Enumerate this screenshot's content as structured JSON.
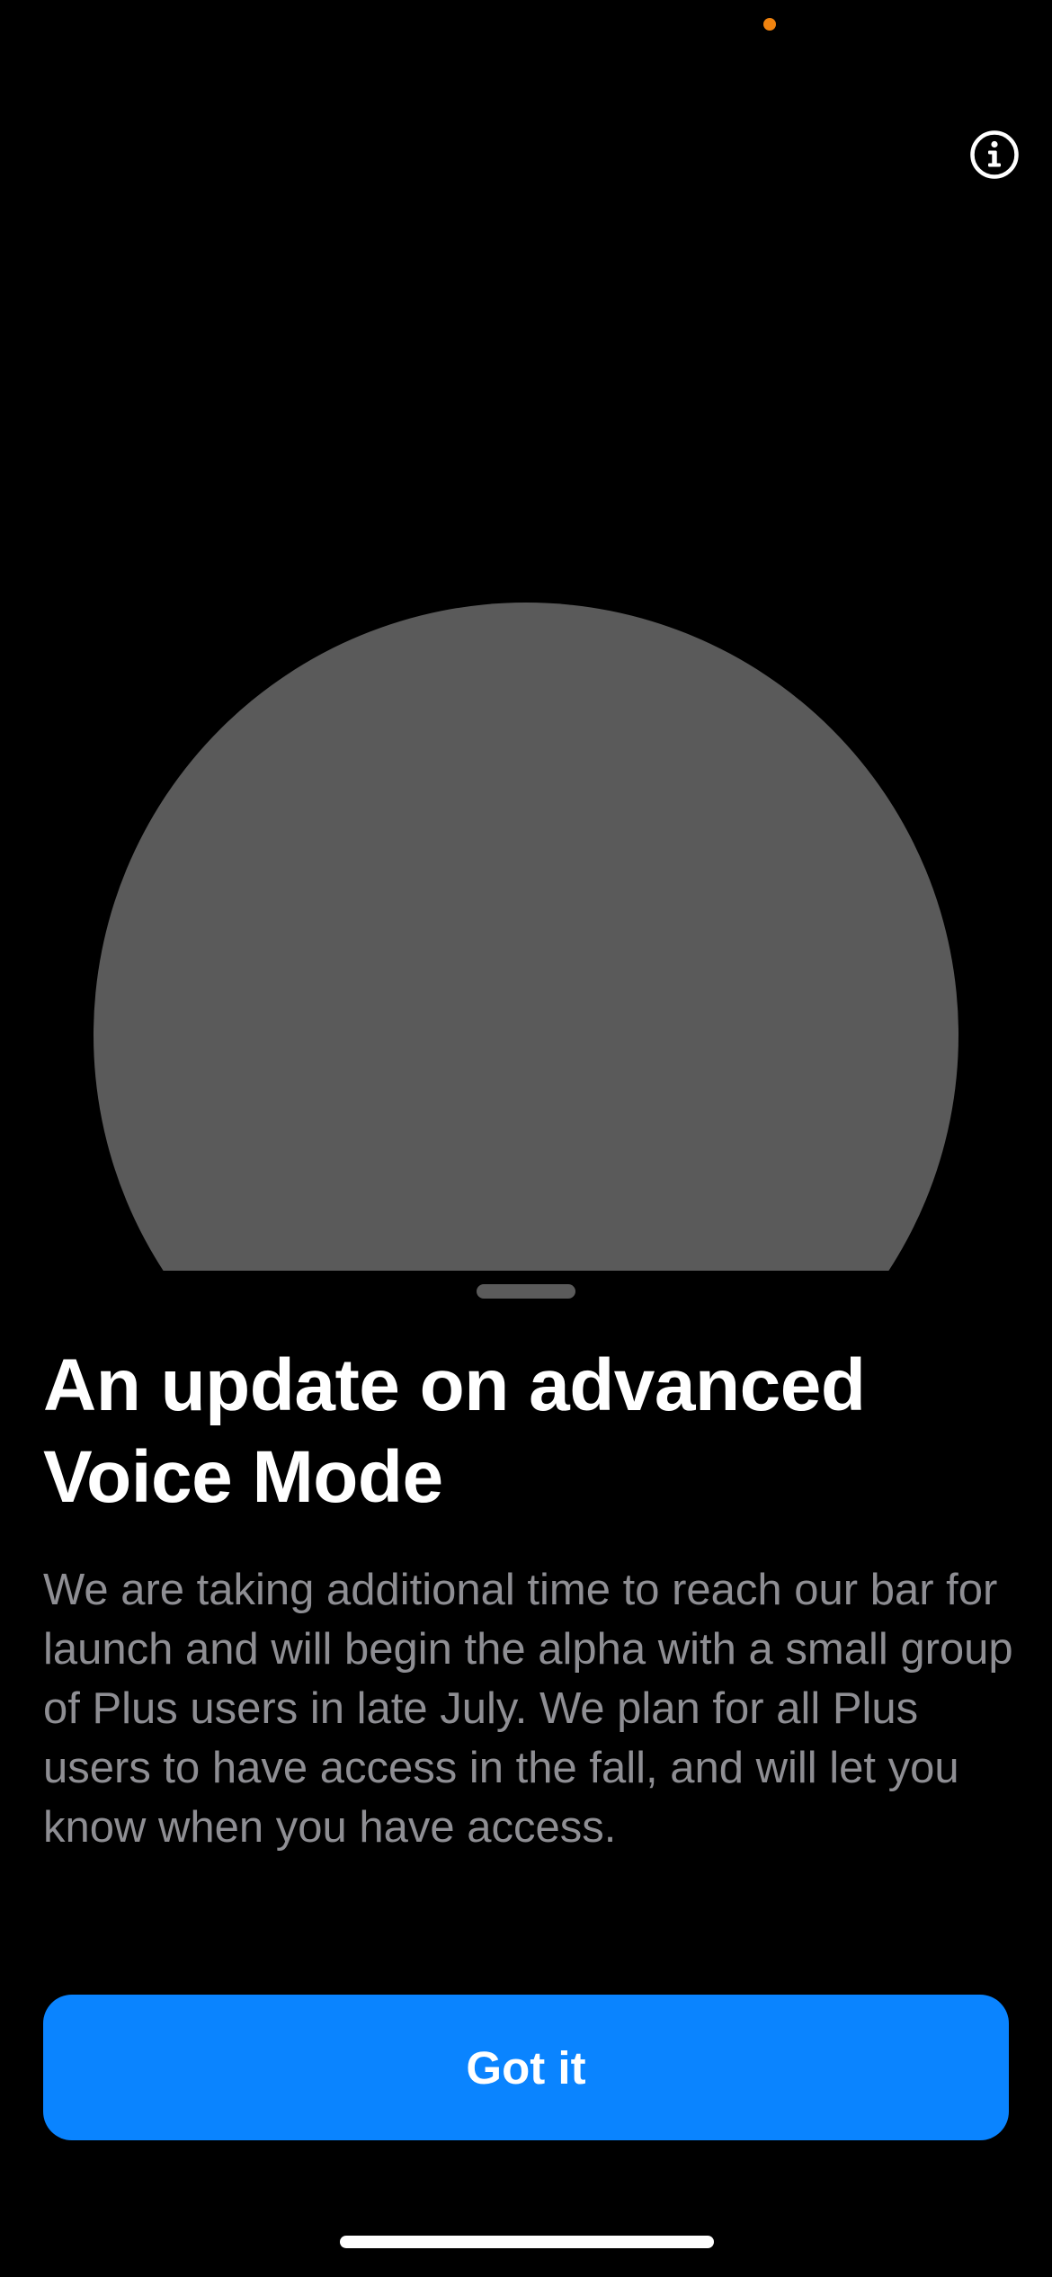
{
  "colors": {
    "background": "#000000",
    "orb": "#5a5a5a",
    "title": "#ffffff",
    "body_text": "#8e8e93",
    "button_bg": "#0a84ff",
    "button_text": "#ffffff",
    "status_dot": "#f0830f",
    "home_indicator": "#ffffff",
    "icon": "#ffffff"
  },
  "header": {
    "info_icon": "info-circle-icon"
  },
  "sheet": {
    "title": "An update on advanced Voice Mode",
    "body": "We are taking additional time to reach our bar for launch and will begin the alpha with a small group of Plus users in late July. We plan for all Plus users to have access in the fall, and will let you know when you have access.",
    "button_label": "Got it"
  }
}
